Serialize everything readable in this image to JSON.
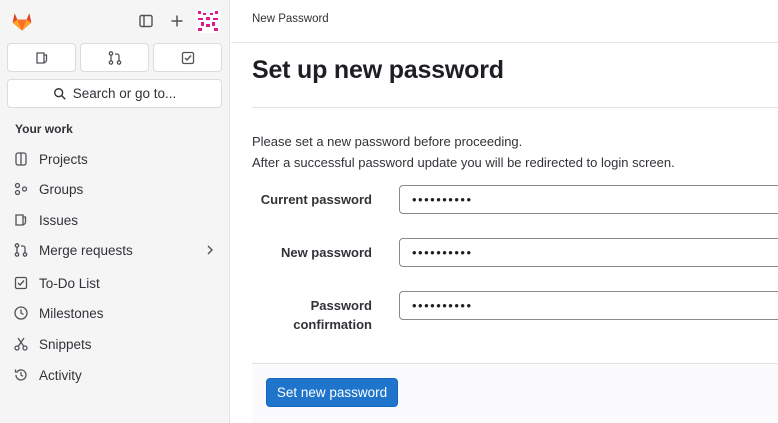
{
  "sidebar": {
    "quick_actions": [
      {
        "icon": "issues-icon"
      },
      {
        "icon": "merge-request-icon"
      },
      {
        "icon": "todo-check-icon"
      }
    ],
    "search_label": "Search or go to...",
    "section_title": "Your work",
    "items": [
      {
        "label": "Projects",
        "icon": "project-icon"
      },
      {
        "label": "Groups",
        "icon": "group-icon"
      },
      {
        "label": "Issues",
        "icon": "issues-icon"
      },
      {
        "label": "Merge requests",
        "icon": "merge-request-icon"
      },
      {
        "label": "To-Do List",
        "icon": "todo-check-icon"
      },
      {
        "label": "Milestones",
        "icon": "milestone-icon"
      },
      {
        "label": "Snippets",
        "icon": "snippet-scissors-icon"
      },
      {
        "label": "Activity",
        "icon": "history-icon"
      }
    ]
  },
  "breadcrumb": "New Password",
  "page": {
    "title": "Set up new password",
    "message_1": "Please set a new password before proceeding.",
    "message_2": "After a successful password update you will be redirected to login screen."
  },
  "form": {
    "current_password_label": "Current password",
    "current_password_value": "••••••••••",
    "new_password_label": "New password",
    "new_password_value": "••••••••••",
    "confirm_label_line1": "Password",
    "confirm_label_line2": "confirmation",
    "confirm_value": "••••••••••",
    "submit_label": "Set new password"
  },
  "colors": {
    "brand_orange": "#e24329",
    "primary_blue": "#1f75cb",
    "avatar_pink": "#e0198c"
  }
}
